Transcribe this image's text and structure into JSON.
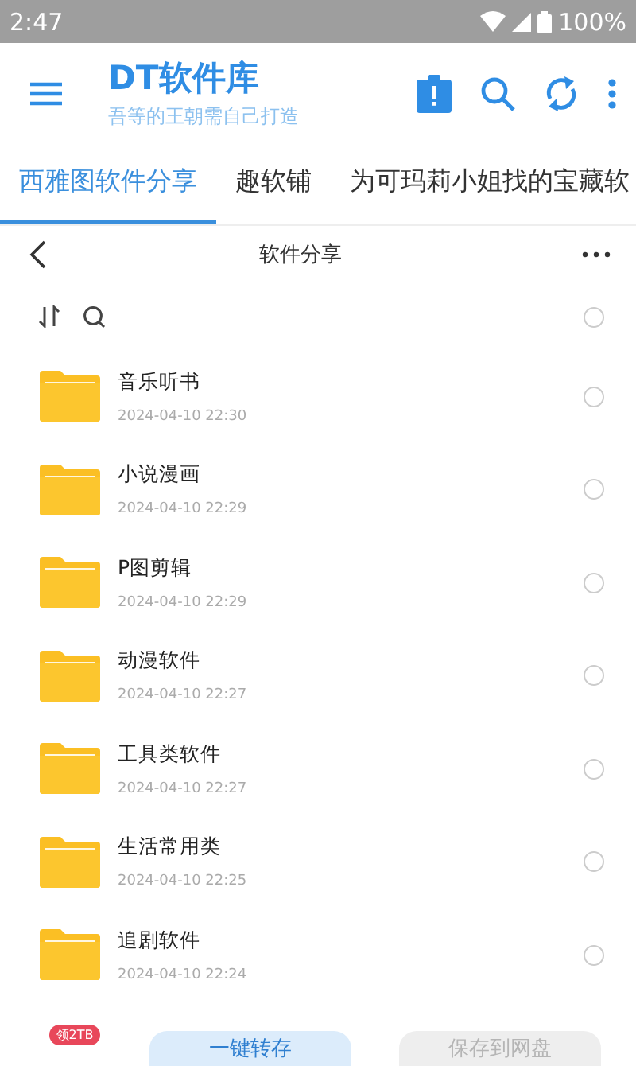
{
  "status_bar": {
    "time": "2:47",
    "battery": "100%"
  },
  "app_bar": {
    "title": "DT软件库",
    "subtitle": "吾等的王朝需自己打造"
  },
  "tabs": [
    {
      "label": "西雅图软件分享",
      "selected": true
    },
    {
      "label": "趣软铺",
      "selected": false
    },
    {
      "label": "为可玛莉小姐找的宝藏软",
      "selected": false
    }
  ],
  "folder_header": {
    "title": "软件分享"
  },
  "select_all": {
    "selected": false
  },
  "files": [
    {
      "name": "音乐听书",
      "date": "2024-04-10 22:30",
      "selected": false
    },
    {
      "name": "小说漫画",
      "date": "2024-04-10 22:29",
      "selected": false
    },
    {
      "name": "P图剪辑",
      "date": "2024-04-10 22:29",
      "selected": false
    },
    {
      "name": "动漫软件",
      "date": "2024-04-10 22:27",
      "selected": false
    },
    {
      "name": "工具类软件",
      "date": "2024-04-10 22:27",
      "selected": false
    },
    {
      "name": "生活常用类",
      "date": "2024-04-10 22:25",
      "selected": false
    },
    {
      "name": "追剧软件",
      "date": "2024-04-10 22:24",
      "selected": false
    }
  ],
  "bottom_bar": {
    "badge": "领2TB",
    "primary_button": "一键转存",
    "secondary_button": "保存到网盘"
  }
}
